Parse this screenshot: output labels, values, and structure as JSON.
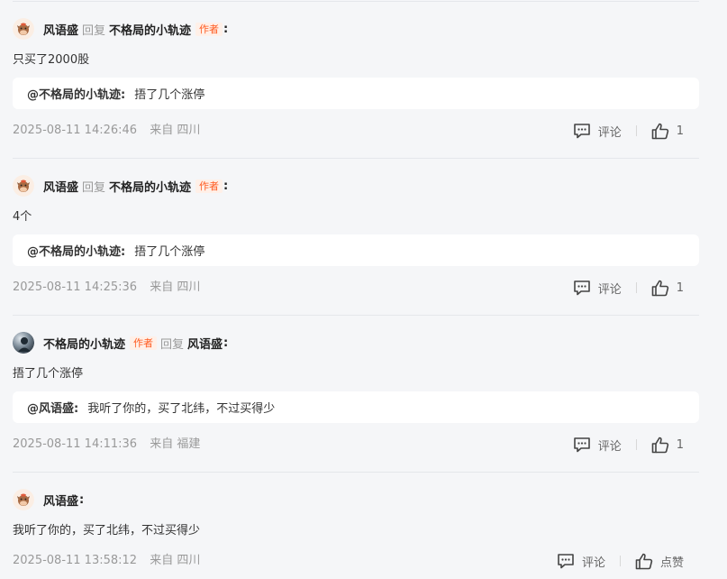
{
  "reply_word": "回复",
  "author_tag": "作者",
  "colon": ":",
  "comments": [
    {
      "user": "风语盛",
      "reply_to": "不格局的小轨迹",
      "text": "只买了2000股",
      "quote_user": "@不格局的小轨迹:",
      "quote_text": "捂了几个涨停",
      "time": "2025-08-11 14:26:46",
      "location": "来自 四川",
      "comment_label": "评论",
      "like_label": "1"
    },
    {
      "user": "风语盛",
      "reply_to": "不格局的小轨迹",
      "text": "4个",
      "quote_user": "@不格局的小轨迹:",
      "quote_text": "捂了几个涨停",
      "time": "2025-08-11 14:25:36",
      "location": "来自 四川",
      "comment_label": "评论",
      "like_label": "1"
    },
    {
      "user": "不格局的小轨迹",
      "reply_to": "风语盛",
      "text": "捂了几个涨停",
      "quote_user": "@风语盛:",
      "quote_text": "我听了你的，买了北纬，不过买得少",
      "time": "2025-08-11 14:11:36",
      "location": "来自 福建",
      "comment_label": "评论",
      "like_label": "1"
    },
    {
      "user": "风语盛",
      "text": "我听了你的，买了北纬，不过买得少",
      "time": "2025-08-11 13:58:12",
      "location": "来自 四川",
      "comment_label": "评论",
      "like_label": "点赞"
    }
  ],
  "icons": {
    "comment": "comment-bubble-icon",
    "like": "thumbs-up-icon"
  },
  "colors": {
    "background": "#f5f6f8",
    "author_tag_text": "#ff5a1f",
    "author_tag_bg": "#fff0e8",
    "meta_text": "#999999"
  }
}
